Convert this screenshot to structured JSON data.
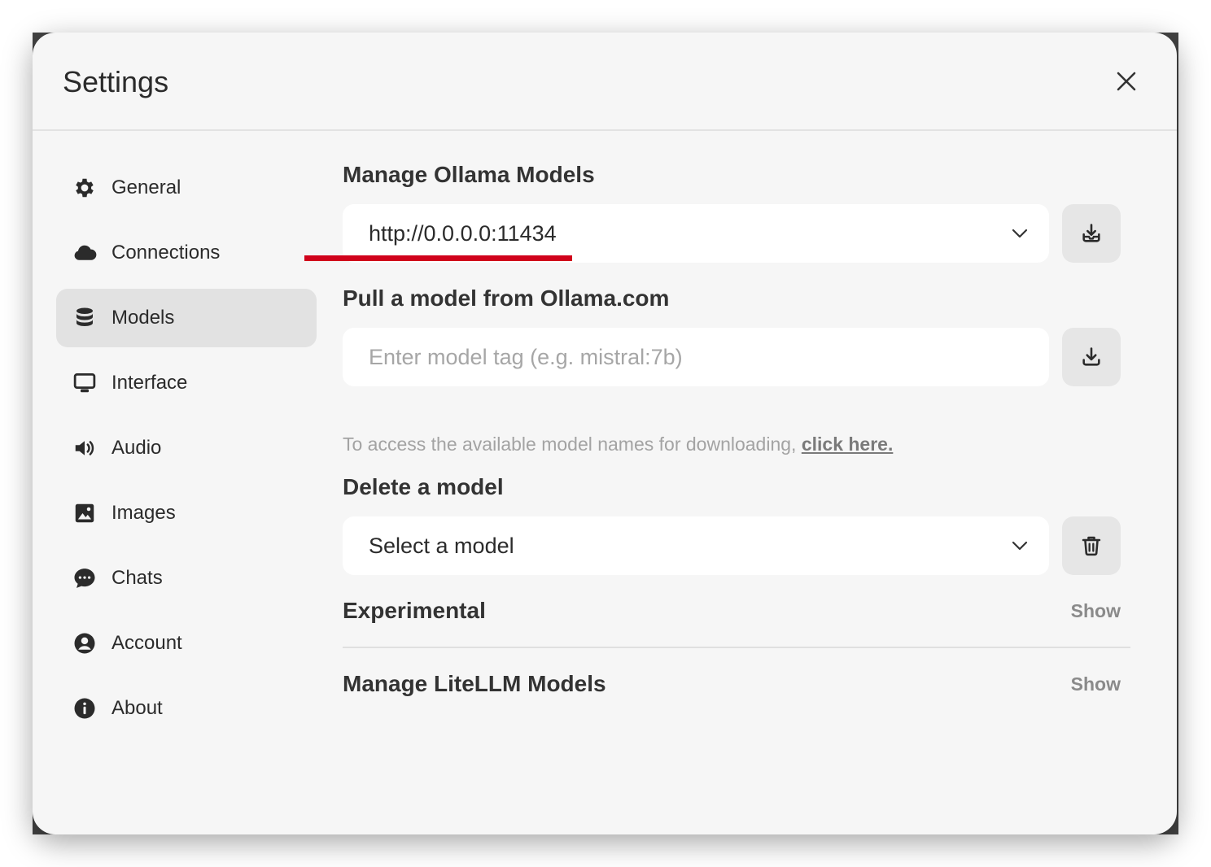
{
  "modal": {
    "title": "Settings",
    "close_icon": "close-icon"
  },
  "sidebar": {
    "items": [
      {
        "label": "General",
        "icon": "gear-icon",
        "active": false
      },
      {
        "label": "Connections",
        "icon": "cloud-icon",
        "active": false
      },
      {
        "label": "Models",
        "icon": "database-icon",
        "active": true
      },
      {
        "label": "Interface",
        "icon": "monitor-icon",
        "active": false
      },
      {
        "label": "Audio",
        "icon": "speaker-icon",
        "active": false
      },
      {
        "label": "Images",
        "icon": "image-icon",
        "active": false
      },
      {
        "label": "Chats",
        "icon": "chat-bubble-icon",
        "active": false
      },
      {
        "label": "Account",
        "icon": "user-circle-icon",
        "active": false
      },
      {
        "label": "About",
        "icon": "info-icon",
        "active": false
      }
    ]
  },
  "main": {
    "manage_ollama": {
      "title": "Manage Ollama Models",
      "selected_url": "http://0.0.0.0:11434"
    },
    "pull_model": {
      "title": "Pull a model from Ollama.com",
      "placeholder": "Enter model tag (e.g. mistral:7b)",
      "value": "",
      "hint_text": "To access the available model names for downloading, ",
      "hint_link": "click here."
    },
    "delete_model": {
      "title": "Delete a model",
      "selected": "Select a model"
    },
    "experimental": {
      "title": "Experimental",
      "toggle_label": "Show"
    },
    "litellm": {
      "title": "Manage LiteLLM Models",
      "toggle_label": "Show"
    }
  },
  "colors": {
    "accent_underline": "#d0021b",
    "active_nav_bg": "#e2e2e2",
    "modal_bg": "#f6f6f6"
  }
}
